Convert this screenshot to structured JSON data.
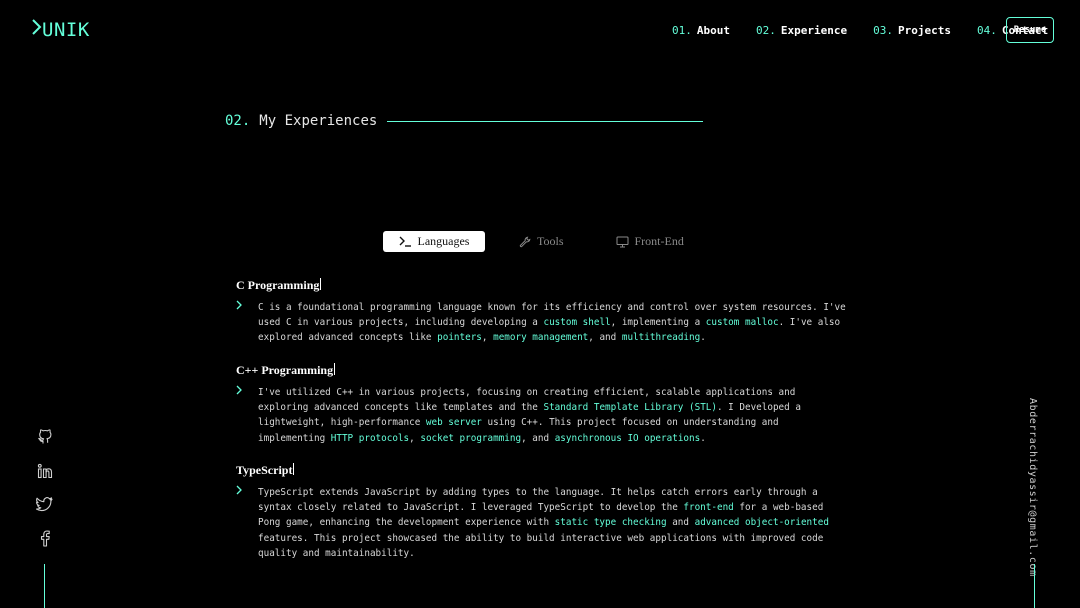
{
  "logo": {
    "text": "UNIK"
  },
  "nav": [
    {
      "num": "01.",
      "label": "About"
    },
    {
      "num": "02.",
      "label": "Experience"
    },
    {
      "num": "03.",
      "label": "Projects"
    },
    {
      "num": "04.",
      "label": "Contact"
    }
  ],
  "resume_label": "Resume",
  "section": {
    "num": "02.",
    "title": "My Experiences"
  },
  "tabs": [
    {
      "label": "Languages",
      "icon": "terminal-icon",
      "active": true
    },
    {
      "label": "Tools",
      "icon": "wrench-icon",
      "active": false
    },
    {
      "label": "Front-End",
      "icon": "monitor-icon",
      "active": false
    }
  ],
  "experiences": [
    {
      "title": "C Programming",
      "p1": "C is a foundational programming language known for its efficiency and control over system resources. I've used C in various projects, including developing a ",
      "h1": "custom shell",
      "p2": ", implementing a ",
      "h2": "custom malloc",
      "p3": ". I've also explored advanced concepts like ",
      "h3": "pointers",
      "p4": ", ",
      "h4": "memory management",
      "p5": ", and ",
      "h5": "multithreading",
      "p6": "."
    },
    {
      "title": "C++ Programming",
      "p1": "I've utilized C++ in various projects, focusing on creating efficient, scalable applications and exploring advanced concepts like templates and the ",
      "h1": "Standard Template Library (STL)",
      "p2": ". I Developed a lightweight, high-performance ",
      "h2": "web server",
      "p3": " using C++. This project focused on understanding and implementing ",
      "h3": "HTTP protocols",
      "p4": ", ",
      "h4": "socket programming",
      "p5": ", and ",
      "h5": "asynchronous IO operations",
      "p6": "."
    },
    {
      "title": "TypeScript",
      "p1": "TypeScript extends JavaScript by adding types to the language. It helps catch errors early through a syntax closely related to JavaScript. I leveraged TypeScript to develop the ",
      "h1": "front-end",
      "p2": " for a web-based Pong game, enhancing the development experience with ",
      "h2": "static type checking",
      "p3": " and ",
      "h3": "advanced object-oriented",
      "p4": " features. This project showcased the ability to build interactive web applications with improved code quality and maintainability."
    }
  ],
  "socials": [
    "github-icon",
    "linkedin-icon",
    "twitter-icon",
    "facebook-icon"
  ],
  "email": "Abderrachidyassir@gmail.com",
  "colors": {
    "accent": "#64ffda",
    "background": "#000000"
  }
}
